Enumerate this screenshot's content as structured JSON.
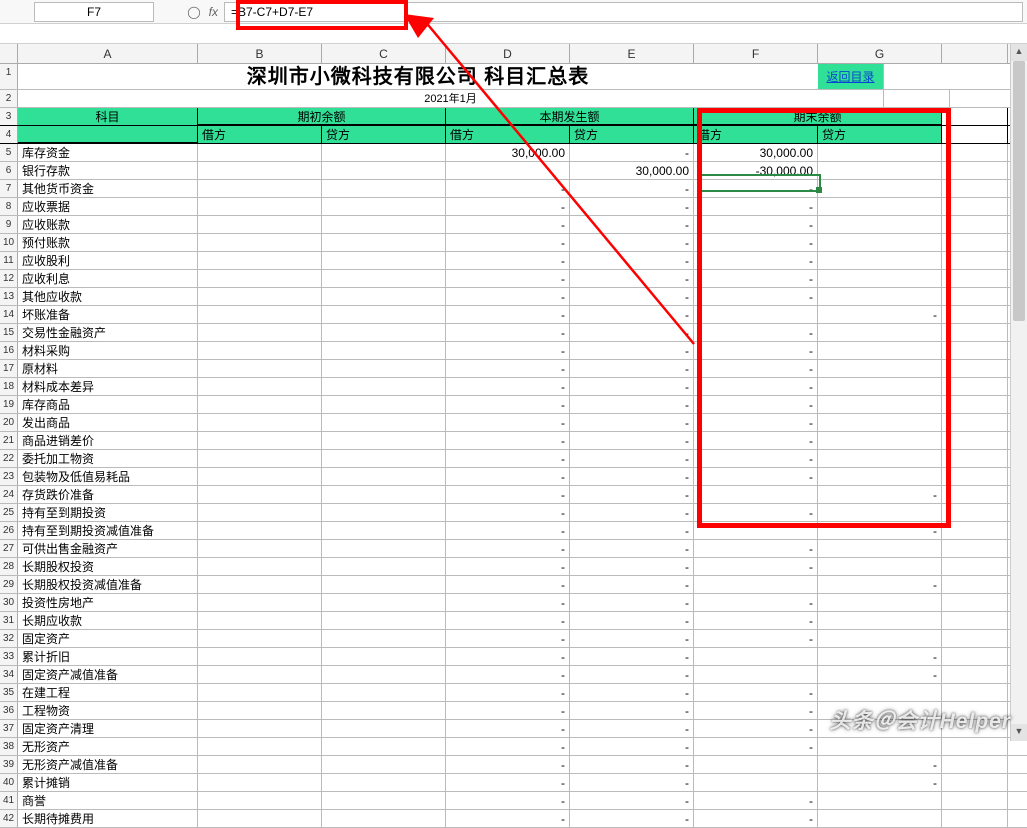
{
  "nameBox": "F7",
  "formula": "=B7-C7+D7-E7",
  "columns": [
    "A",
    "B",
    "C",
    "D",
    "E",
    "F",
    "G"
  ],
  "title": "深圳市小微科技有限公司  科目汇总表",
  "period": "2021年1月",
  "linkLabel": "返回目录",
  "headers": {
    "subject": "科目",
    "group1": "期初余额",
    "group2": "本期发生额",
    "group3": "期末余额",
    "debit": "借方",
    "credit": "贷方"
  },
  "rows": [
    {
      "n": 5,
      "a": "库存资金",
      "d": "30,000.00",
      "e": "-",
      "f": "30,000.00",
      "g": ""
    },
    {
      "n": 6,
      "a": "银行存款",
      "d": "",
      "e": "30,000.00",
      "f": "-30,000.00",
      "g": ""
    },
    {
      "n": 7,
      "a": "其他货币资金",
      "d": "-",
      "e": "-",
      "f": "-",
      "g": ""
    },
    {
      "n": 8,
      "a": "应收票据",
      "d": "-",
      "e": "-",
      "f": "-",
      "g": ""
    },
    {
      "n": 9,
      "a": "应收账款",
      "d": "-",
      "e": "-",
      "f": "-",
      "g": ""
    },
    {
      "n": 10,
      "a": "预付账款",
      "d": "-",
      "e": "-",
      "f": "-",
      "g": ""
    },
    {
      "n": 11,
      "a": "应收股利",
      "d": "-",
      "e": "-",
      "f": "-",
      "g": ""
    },
    {
      "n": 12,
      "a": "应收利息",
      "d": "-",
      "e": "-",
      "f": "-",
      "g": ""
    },
    {
      "n": 13,
      "a": "其他应收款",
      "d": "-",
      "e": "-",
      "f": "-",
      "g": ""
    },
    {
      "n": 14,
      "a": "坏账准备",
      "d": "-",
      "e": "-",
      "f": "",
      "g": "-"
    },
    {
      "n": 15,
      "a": "交易性金融资产",
      "d": "-",
      "e": "-",
      "f": "-",
      "g": ""
    },
    {
      "n": 16,
      "a": "材料采购",
      "d": "-",
      "e": "-",
      "f": "-",
      "g": ""
    },
    {
      "n": 17,
      "a": "原材料",
      "d": "-",
      "e": "-",
      "f": "-",
      "g": ""
    },
    {
      "n": 18,
      "a": "材料成本差异",
      "d": "-",
      "e": "-",
      "f": "-",
      "g": ""
    },
    {
      "n": 19,
      "a": "库存商品",
      "d": "-",
      "e": "-",
      "f": "-",
      "g": ""
    },
    {
      "n": 20,
      "a": "发出商品",
      "d": "-",
      "e": "-",
      "f": "-",
      "g": ""
    },
    {
      "n": 21,
      "a": "商品进销差价",
      "d": "-",
      "e": "-",
      "f": "-",
      "g": ""
    },
    {
      "n": 22,
      "a": "委托加工物资",
      "d": "-",
      "e": "-",
      "f": "-",
      "g": ""
    },
    {
      "n": 23,
      "a": "包装物及低值易耗品",
      "d": "-",
      "e": "-",
      "f": "-",
      "g": ""
    },
    {
      "n": 24,
      "a": "存货跌价准备",
      "d": "-",
      "e": "-",
      "f": "",
      "g": "-"
    },
    {
      "n": 25,
      "a": "持有至到期投资",
      "d": "-",
      "e": "-",
      "f": "-",
      "g": ""
    },
    {
      "n": 26,
      "a": "持有至到期投资减值准备",
      "d": "-",
      "e": "-",
      "f": "",
      "g": "-"
    },
    {
      "n": 27,
      "a": "可供出售金融资产",
      "d": "-",
      "e": "-",
      "f": "-",
      "g": ""
    },
    {
      "n": 28,
      "a": "长期股权投资",
      "d": "-",
      "e": "-",
      "f": "-",
      "g": ""
    },
    {
      "n": 29,
      "a": "长期股权投资减值准备",
      "d": "-",
      "e": "-",
      "f": "",
      "g": "-"
    },
    {
      "n": 30,
      "a": "投资性房地产",
      "d": "-",
      "e": "-",
      "f": "-",
      "g": ""
    },
    {
      "n": 31,
      "a": "长期应收款",
      "d": "-",
      "e": "-",
      "f": "-",
      "g": ""
    },
    {
      "n": 32,
      "a": "固定资产",
      "d": "-",
      "e": "-",
      "f": "-",
      "g": ""
    },
    {
      "n": 33,
      "a": "累计折旧",
      "d": "-",
      "e": "-",
      "f": "",
      "g": "-"
    },
    {
      "n": 34,
      "a": "固定资产减值准备",
      "d": "-",
      "e": "-",
      "f": "",
      "g": "-"
    },
    {
      "n": 35,
      "a": "在建工程",
      "d": "-",
      "e": "-",
      "f": "-",
      "g": ""
    },
    {
      "n": 36,
      "a": "工程物资",
      "d": "-",
      "e": "-",
      "f": "-",
      "g": ""
    },
    {
      "n": 37,
      "a": "固定资产清理",
      "d": "-",
      "e": "-",
      "f": "-",
      "g": ""
    },
    {
      "n": 38,
      "a": "无形资产",
      "d": "-",
      "e": "-",
      "f": "-",
      "g": ""
    },
    {
      "n": 39,
      "a": "无形资产减值准备",
      "d": "-",
      "e": "-",
      "f": "",
      "g": "-"
    },
    {
      "n": 40,
      "a": "累计摊销",
      "d": "-",
      "e": "-",
      "f": "",
      "g": "-"
    },
    {
      "n": 41,
      "a": "商誉",
      "d": "-",
      "e": "-",
      "f": "-",
      "g": ""
    },
    {
      "n": 42,
      "a": "长期待摊费用",
      "d": "-",
      "e": "-",
      "f": "-",
      "g": ""
    }
  ],
  "watermark": "头条＠会计Helper"
}
